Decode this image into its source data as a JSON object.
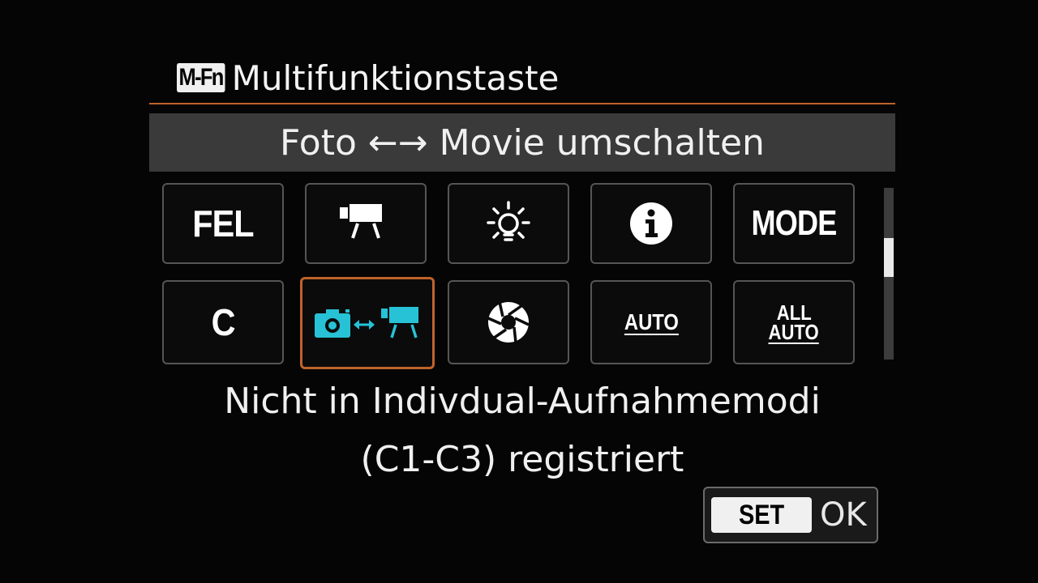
{
  "header": {
    "badge": "M-Fn",
    "title": "Multifunktionstaste"
  },
  "selected_label": "Foto ←→ Movie umschalten",
  "options": [
    {
      "name": "fel",
      "label": "FEL",
      "icon": "text"
    },
    {
      "name": "movie-record",
      "icon": "movie-camera-icon"
    },
    {
      "name": "lcd-illumination",
      "icon": "lightbulb-icon"
    },
    {
      "name": "info",
      "icon": "info-icon"
    },
    {
      "name": "mode",
      "label": "MODE",
      "icon": "text"
    },
    {
      "name": "c",
      "label": "C",
      "icon": "text"
    },
    {
      "name": "photo-movie-switch",
      "icon": "photo-movie-switch-icon",
      "selected": true
    },
    {
      "name": "aperture",
      "icon": "aperture-icon"
    },
    {
      "name": "auto",
      "label": "AUTO",
      "icon": "text"
    },
    {
      "name": "all-auto",
      "label_top": "ALL",
      "label_bottom": "AUTO",
      "icon": "text"
    }
  ],
  "description_line1": "Nicht in Indivdual-Aufnahmemodi",
  "description_line2": "(C1-C3) registriert",
  "footer": {
    "set_label": "SET",
    "ok_label": "OK"
  },
  "colors": {
    "accent": "#c0632a",
    "selected_icon": "#27c2d6",
    "background": "#050505",
    "banner": "#3a3a3a"
  }
}
